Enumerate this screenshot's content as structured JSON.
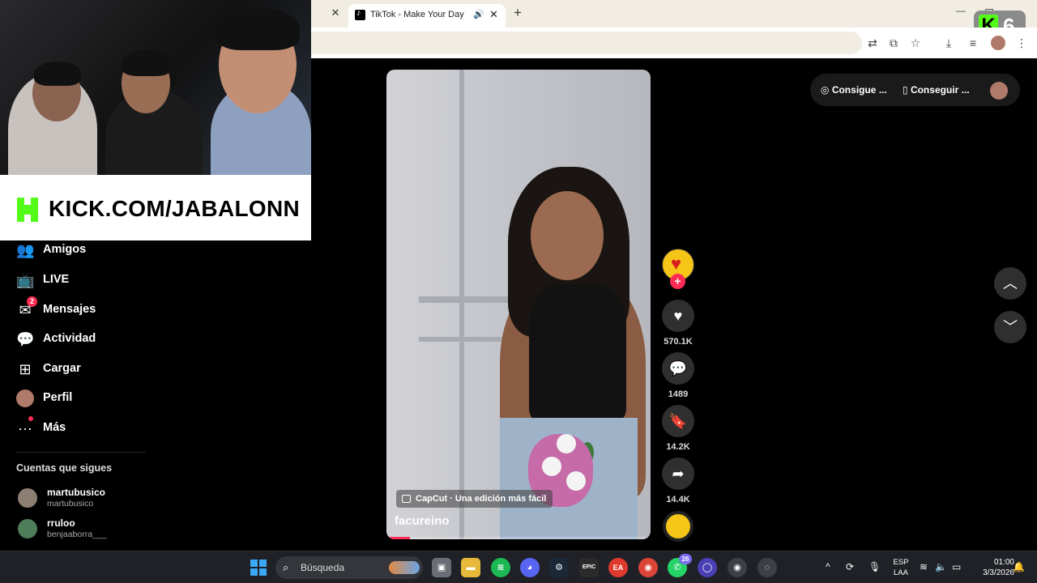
{
  "browser": {
    "tab_title": "TikTok - Make Your Day",
    "kick_badge_number": "6"
  },
  "stream_overlay": {
    "banner_text": "KICK.COM/JABALONN"
  },
  "sidebar": {
    "items": [
      {
        "label": "Amigos",
        "icon": "friends-icon"
      },
      {
        "label": "LIVE",
        "icon": "live-tv-icon"
      },
      {
        "label": "Mensajes",
        "icon": "messages-icon",
        "badge": "2"
      },
      {
        "label": "Actividad",
        "icon": "activity-icon"
      },
      {
        "label": "Cargar",
        "icon": "upload-plus-icon"
      },
      {
        "label": "Perfil",
        "icon": "avatar"
      },
      {
        "label": "Más",
        "icon": "more-dots-icon"
      }
    ],
    "following_heading": "Cuentas que sigues",
    "following": [
      {
        "name": "martubusico",
        "handle": "martubusico"
      },
      {
        "name": "rruloo",
        "handle": "benjaaborra___"
      }
    ]
  },
  "video": {
    "capcut_tag": "CapCut · Una edición más fácil",
    "author": "facureino",
    "progress_fraction": 0.09
  },
  "actions": {
    "likes": "570.1K",
    "comments": "1489",
    "saves": "14.2K",
    "shares": "14.4K"
  },
  "top_right": {
    "pill_1": "Consigue ...",
    "pill_2": "Conseguir ..."
  },
  "taskbar": {
    "search_placeholder": "Búsqueda",
    "whatsapp_badge": "26",
    "lang_1": "ESP",
    "lang_2": "LAA",
    "time": "01:00",
    "date": "3/3/2026"
  }
}
